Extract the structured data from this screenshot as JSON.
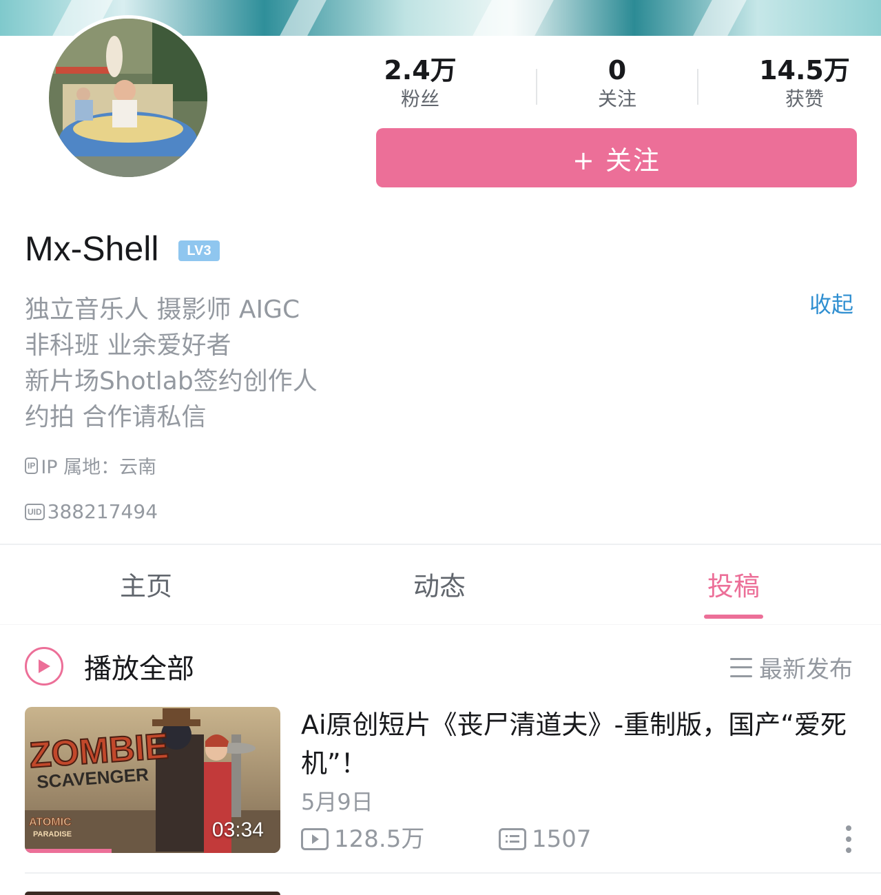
{
  "profile": {
    "name": "Mx-Shell",
    "level": "LV3",
    "stats": [
      {
        "value": "2.4万",
        "label": "粉丝"
      },
      {
        "value": "0",
        "label": "关注"
      },
      {
        "value": "14.5万",
        "label": "获赞"
      }
    ],
    "follow_label": "+ 关注",
    "bio_lines": [
      "独立音乐人 摄影师 AIGC",
      "非科班 业余爱好者",
      "新片场Shotlab签约创作人",
      "约拍 合作请私信"
    ],
    "collapse_label": "收起",
    "ip_icon": "IP",
    "ip_location": "IP 属地：云南",
    "uid_icon": "UID",
    "uid": "388217494"
  },
  "tabs": [
    {
      "label": "主页",
      "active": false
    },
    {
      "label": "动态",
      "active": false
    },
    {
      "label": "投稿",
      "active": true
    }
  ],
  "list_header": {
    "play_all_label": "播放全部",
    "sort_label": "最新发布"
  },
  "videos": [
    {
      "title": "Ai原创短片《丧尸清道夫》-重制版，国产“爱死机”！",
      "date": "5月9日",
      "duration": "03:34",
      "views": "128.5万",
      "comments": "1507",
      "thumbnail_text": [
        "ZOMBIE",
        "SCAVENGER",
        "ATOMIC",
        "PARADISE"
      ],
      "watched_fraction": 0.34
    }
  ],
  "colors": {
    "accent": "#ec6f98",
    "link": "#2f8fd1",
    "muted": "#9499a0",
    "level_badge": "#8fc6ef"
  }
}
